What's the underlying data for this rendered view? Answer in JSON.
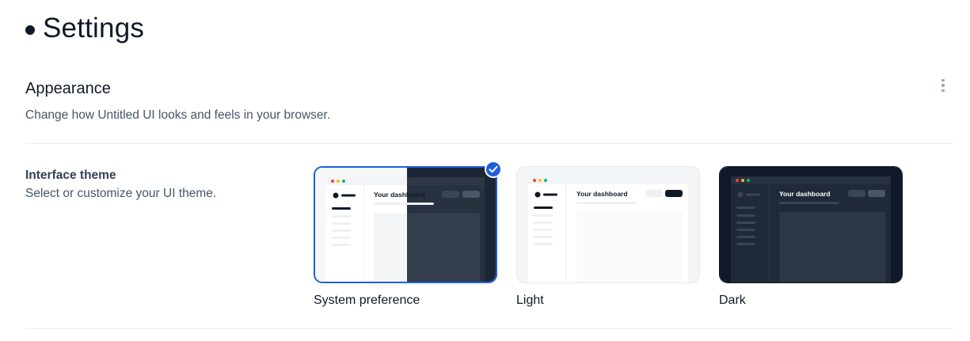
{
  "header": {
    "title": "Settings"
  },
  "appearance": {
    "title": "Appearance",
    "description": "Change how Untitled UI looks and feels in your browser.",
    "menu_icon": "more-vertical-icon"
  },
  "interface_theme": {
    "label": "Interface theme",
    "hint": "Select or customize your UI theme.",
    "options": [
      {
        "name": "System preference",
        "preview_title": "Your dashboard",
        "selected": true
      },
      {
        "name": "Light",
        "preview_title": "Your dashboard",
        "selected": false
      },
      {
        "name": "Dark",
        "preview_title": "Your dashboard",
        "selected": false
      }
    ]
  },
  "colors": {
    "accent": "#1e5fd9",
    "text_primary": "#101828",
    "text_secondary": "#475467",
    "divider": "#eaecf0",
    "dark_preview_bg": "#1d2634",
    "window_dot_red": "#f04438",
    "window_dot_yellow": "#f7b924",
    "window_dot_green": "#12b76a"
  }
}
